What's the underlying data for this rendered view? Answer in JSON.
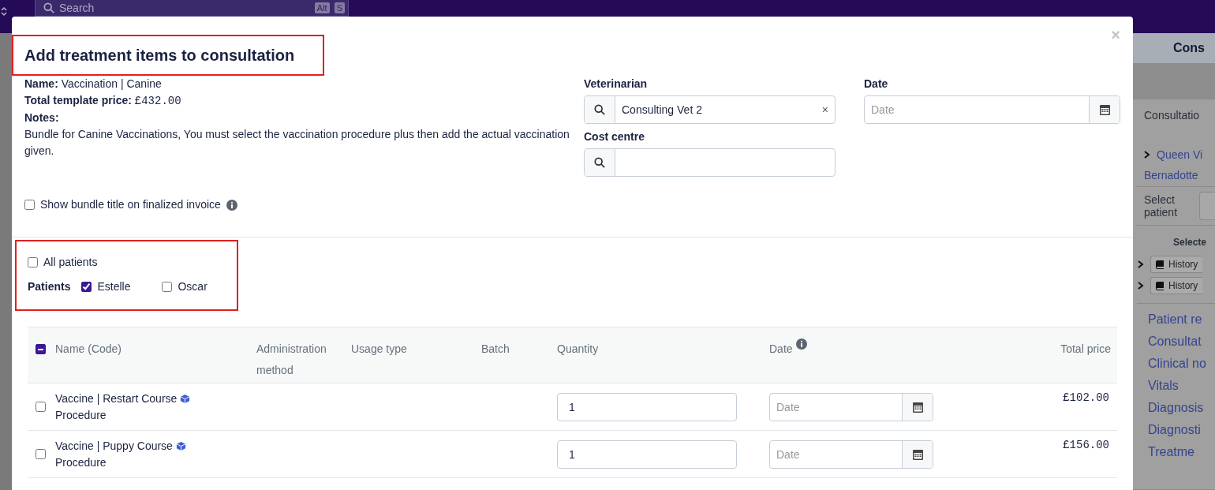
{
  "topbar": {
    "search_placeholder": "Search",
    "shortcut": [
      "Alt",
      "S"
    ]
  },
  "background_panel": {
    "header": "Cons",
    "tab": "Consultatio",
    "owner": "Queen Vi",
    "client": "Bernadotte",
    "select_patient_label": "Select patient",
    "selected_heading": "Selecte",
    "history_items": [
      "History",
      "History"
    ],
    "nav": [
      "Patient re",
      "Consultat",
      "Clinical no",
      "Vitals",
      "Diagnosis",
      "Diagnosti",
      "Treatme"
    ]
  },
  "modal": {
    "title": "Add treatment items to consultation",
    "close": "×",
    "name_label": "Name:",
    "name": "Vaccination | Canine",
    "price_label": "Total template price:",
    "price": "£432.00",
    "notes_label": "Notes:",
    "notes": "Bundle for Canine Vaccinations, You must select the vaccination procedure plus then add the actual vaccination given.",
    "show_bundle_title": {
      "label": "Show bundle title on finalized invoice",
      "checked": false
    },
    "veterinarian": {
      "label": "Veterinarian",
      "value": "Consulting Vet 2",
      "clear": "×"
    },
    "date": {
      "label": "Date",
      "placeholder": "Date"
    },
    "cost_centre": {
      "label": "Cost centre"
    },
    "all_patients": {
      "label": "All patients",
      "checked": false
    },
    "patients": {
      "label": "Patients",
      "items": [
        {
          "name": "Estelle",
          "checked": true
        },
        {
          "name": "Oscar",
          "checked": false
        }
      ]
    },
    "table": {
      "select_all_partial": true,
      "columns": [
        "Name (Code)",
        "Administration method",
        "Usage type",
        "Batch",
        "Quantity",
        "Date",
        "Total price"
      ],
      "rows": [
        {
          "name": "Vaccine | Restart Course",
          "type": "Procedure",
          "checked": false,
          "quantity": "1",
          "date_placeholder": "Date",
          "price": "£102.00"
        },
        {
          "name": "Vaccine | Puppy Course",
          "type": "Procedure",
          "checked": false,
          "quantity": "1",
          "date_placeholder": "Date",
          "price": "£156.00"
        }
      ]
    }
  }
}
